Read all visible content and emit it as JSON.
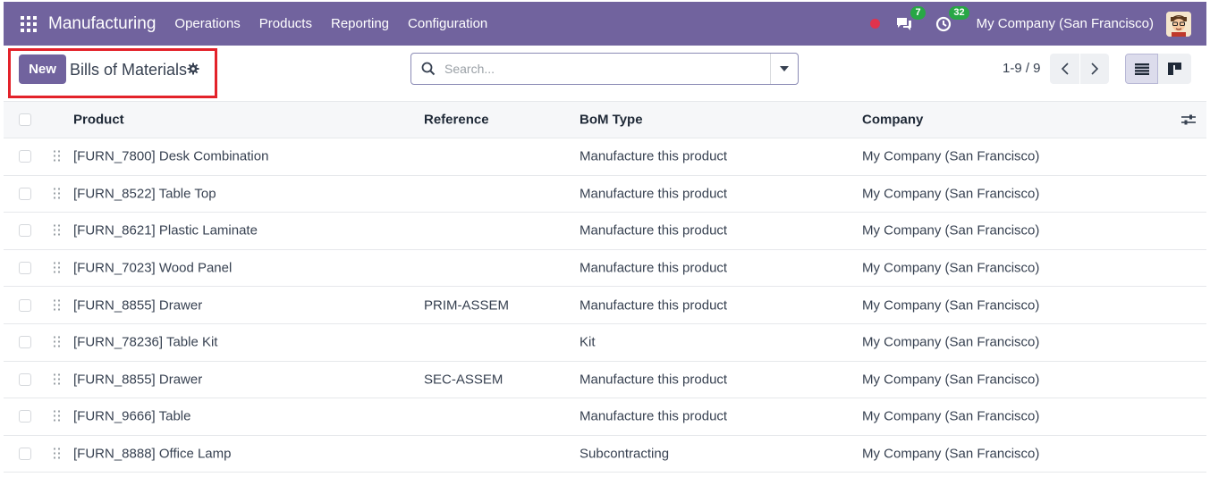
{
  "navbar": {
    "app_name": "Manufacturing",
    "menu": [
      "Operations",
      "Products",
      "Reporting",
      "Configuration"
    ],
    "messages_count": "7",
    "activities_count": "32",
    "company": "My Company (San Francisco)",
    "bg_color": "#71639e"
  },
  "control_panel": {
    "new_label": "New",
    "title": "Bills of Materials",
    "search_placeholder": "Search...",
    "pager": "1-9 / 9"
  },
  "table": {
    "headers": {
      "product": "Product",
      "reference": "Reference",
      "bom_type": "BoM Type",
      "company": "Company"
    },
    "rows": [
      {
        "product": "[FURN_7800] Desk Combination",
        "reference": "",
        "bom_type": "Manufacture this product",
        "company": "My Company (San Francisco)"
      },
      {
        "product": "[FURN_8522] Table Top",
        "reference": "",
        "bom_type": "Manufacture this product",
        "company": "My Company (San Francisco)"
      },
      {
        "product": "[FURN_8621] Plastic Laminate",
        "reference": "",
        "bom_type": "Manufacture this product",
        "company": "My Company (San Francisco)"
      },
      {
        "product": "[FURN_7023] Wood Panel",
        "reference": "",
        "bom_type": "Manufacture this product",
        "company": "My Company (San Francisco)"
      },
      {
        "product": "[FURN_8855] Drawer",
        "reference": "PRIM-ASSEM",
        "bom_type": "Manufacture this product",
        "company": "My Company (San Francisco)"
      },
      {
        "product": "[FURN_78236] Table Kit",
        "reference": "",
        "bom_type": "Kit",
        "company": "My Company (San Francisco)"
      },
      {
        "product": "[FURN_8855] Drawer",
        "reference": "SEC-ASSEM",
        "bom_type": "Manufacture this product",
        "company": "My Company (San Francisco)"
      },
      {
        "product": "[FURN_9666] Table",
        "reference": "",
        "bom_type": "Manufacture this product",
        "company": "My Company (San Francisco)"
      },
      {
        "product": "[FURN_8888] Office Lamp",
        "reference": "",
        "bom_type": "Subcontracting",
        "company": "My Company (San Francisco)"
      }
    ]
  }
}
